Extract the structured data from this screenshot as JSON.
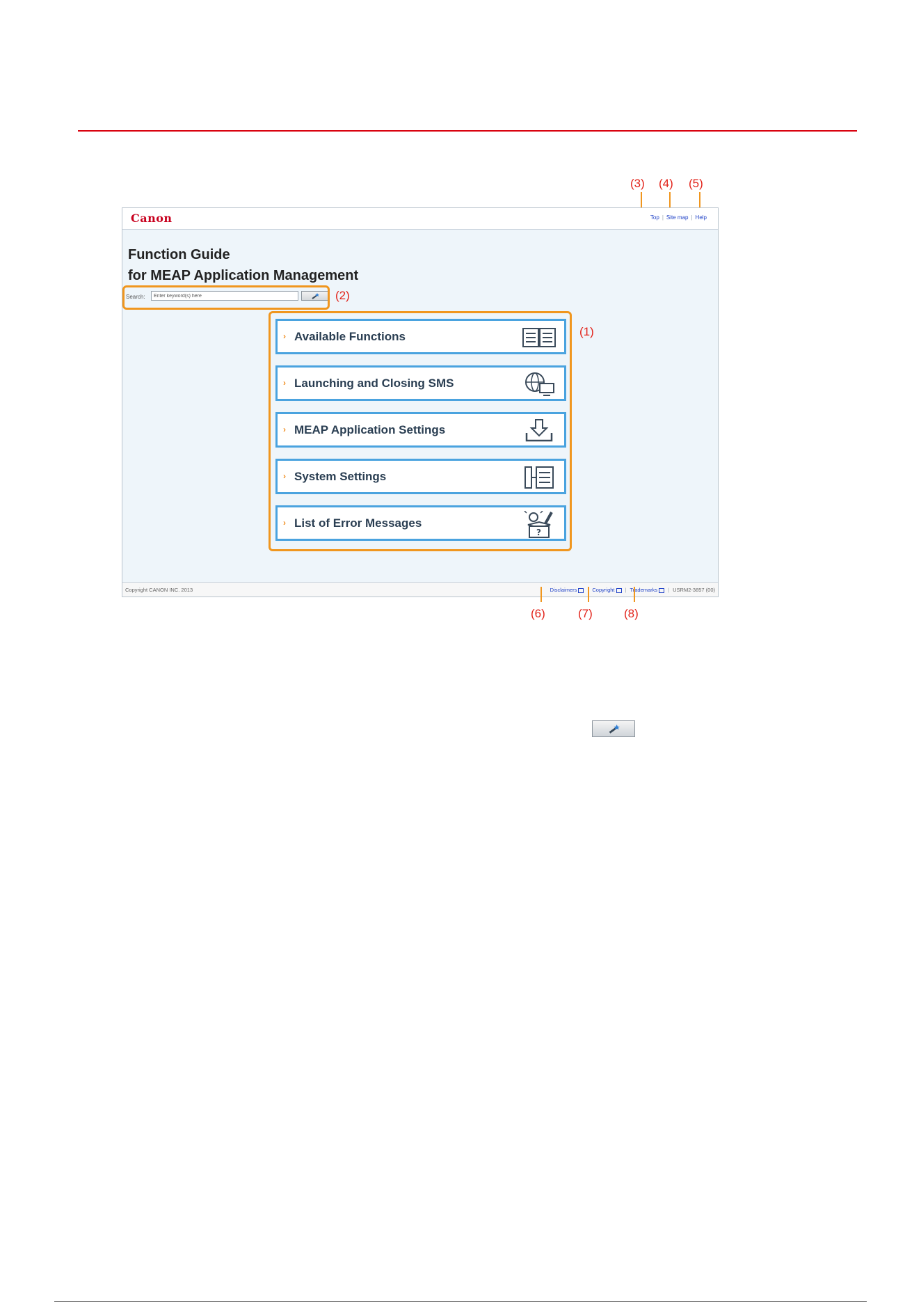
{
  "shot": {
    "logo": "Canon",
    "header_links": [
      "Top",
      "Site map",
      "Help"
    ],
    "title_line1": "Function Guide",
    "title_line2": "for MEAP Application Management",
    "search_label": "Search:",
    "search_value": "Enter keyword(s) here",
    "menu": [
      {
        "label": "Available Functions",
        "icon": "open-book-icon"
      },
      {
        "label": "Launching and Closing SMS",
        "icon": "globe-monitor-icon"
      },
      {
        "label": "MEAP Application Settings",
        "icon": "download-tray-icon"
      },
      {
        "label": "System Settings",
        "icon": "tree-panel-icon"
      },
      {
        "label": "List of Error Messages",
        "icon": "question-box-icon"
      }
    ],
    "footer_copyright": "Copyright CANON INC. 2013",
    "footer_links": [
      "Disclaimers",
      "Copyright",
      "Trademarks"
    ],
    "footer_code": "USRM2-3857 (00)"
  },
  "callouts": {
    "c1": "(1)",
    "c2": "(2)",
    "c3": "(3)",
    "c4": "(4)",
    "c5": "(5)",
    "c6": "(6)",
    "c7": "(7)",
    "c8": "(8)"
  },
  "colors": {
    "accent": "#f0961e",
    "callout_text": "#e2231a",
    "card_border": "#4aa3df",
    "rule": "#d9000d"
  }
}
